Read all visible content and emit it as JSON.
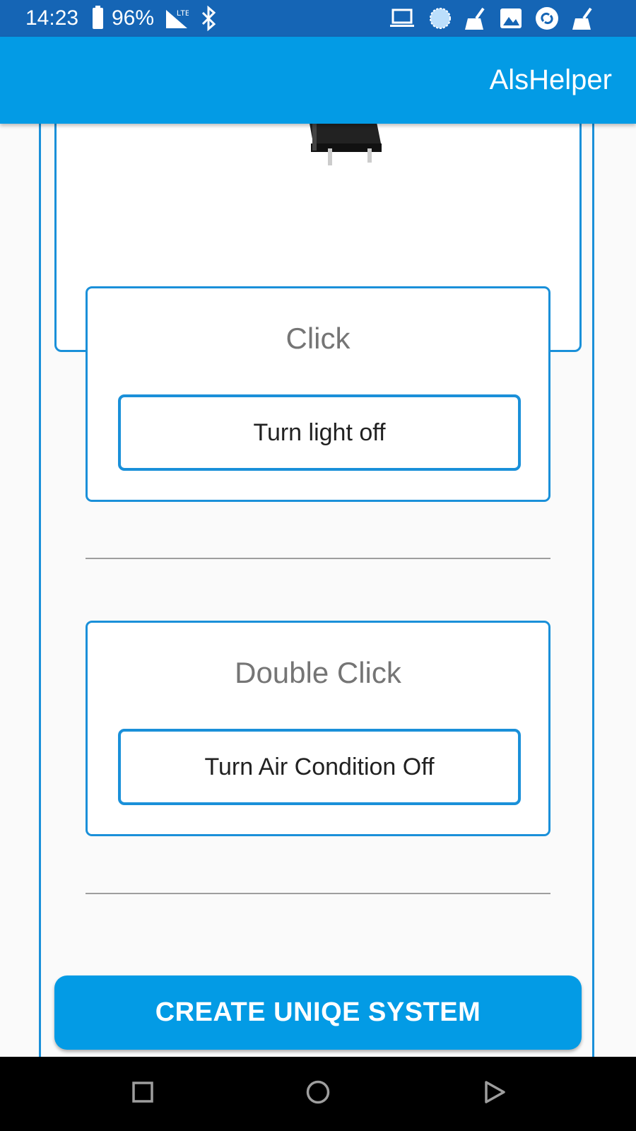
{
  "status_bar": {
    "time": "14:23",
    "battery_percent": "96%",
    "network_label": "LTE",
    "icons": [
      "battery-icon",
      "signal-icon",
      "bluetooth-icon",
      "laptop-icon",
      "loading-icon",
      "broom-icon",
      "image-icon",
      "shazam-icon",
      "broom-icon"
    ]
  },
  "app_bar": {
    "title": "AlsHelper",
    "color": "#039be5"
  },
  "actions": [
    {
      "title": "Click",
      "value": "Turn light off"
    },
    {
      "title": "Double Click",
      "value": "Turn Air Condition Off"
    }
  ],
  "create_button": {
    "label": "CREATE UNIQE SYSTEM"
  },
  "nav_bar": {
    "icons": [
      "recents-square-icon",
      "home-circle-icon",
      "back-triangle-icon"
    ]
  },
  "colors": {
    "accent": "#039be5",
    "status_bar": "#1565b5",
    "border": "#1a90d9"
  }
}
